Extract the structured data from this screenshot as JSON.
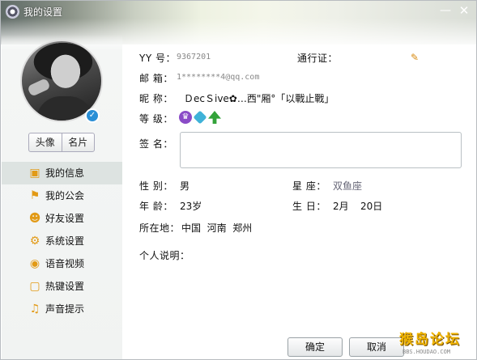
{
  "window": {
    "title": "我的设置",
    "minimize_glyph": "—",
    "close_glyph": "✕"
  },
  "sidebar": {
    "avatar_button": "头像",
    "card_button": "名片",
    "items": [
      {
        "label": "我的信息",
        "icon": "user-card-icon",
        "active": true
      },
      {
        "label": "我的公会",
        "icon": "flag-icon",
        "active": false
      },
      {
        "label": "好友设置",
        "icon": "friend-gear-icon",
        "active": false
      },
      {
        "label": "系统设置",
        "icon": "gear-icon",
        "active": false
      },
      {
        "label": "语音视频",
        "icon": "webcam-icon",
        "active": false
      },
      {
        "label": "热键设置",
        "icon": "keyboard-icon",
        "active": false
      },
      {
        "label": "声音提示",
        "icon": "music-note-icon",
        "active": false
      }
    ]
  },
  "profile": {
    "yy_label": "YY 号：",
    "yy_value": "9367201",
    "pass_label": "通行证：",
    "email_label": "邮 箱：",
    "email_value": "1********4@qq.com",
    "nick_label": "昵 称：",
    "nick_value": "ＤecＳive✿…西\"厢°「以戰止戰」",
    "level_label": "等 级：",
    "level_icons": [
      "crown-icon",
      "diamond-icon",
      "tree-icon"
    ],
    "sig_label": "签 名：",
    "sig_value": "",
    "gender_label": "性 别：",
    "gender_value": "男",
    "star_label": "星 座：",
    "star_value": "双鱼座",
    "age_label": "年 龄：",
    "age_value": "23岁",
    "birthday_label": "生 日：",
    "birthday_month": "2月",
    "birthday_day": "20日",
    "location_label": "所在地：",
    "location_value": "中国  河南  郑州",
    "desc_label": "个人说明："
  },
  "footer": {
    "ok_label": "确定",
    "cancel_label": "取消"
  },
  "watermark": {
    "main": "猴岛论坛",
    "sub": "BBS.HOUDAO.COM"
  },
  "colors": {
    "accent_orange": "#e29a16",
    "active_row": "#dde3e1"
  }
}
